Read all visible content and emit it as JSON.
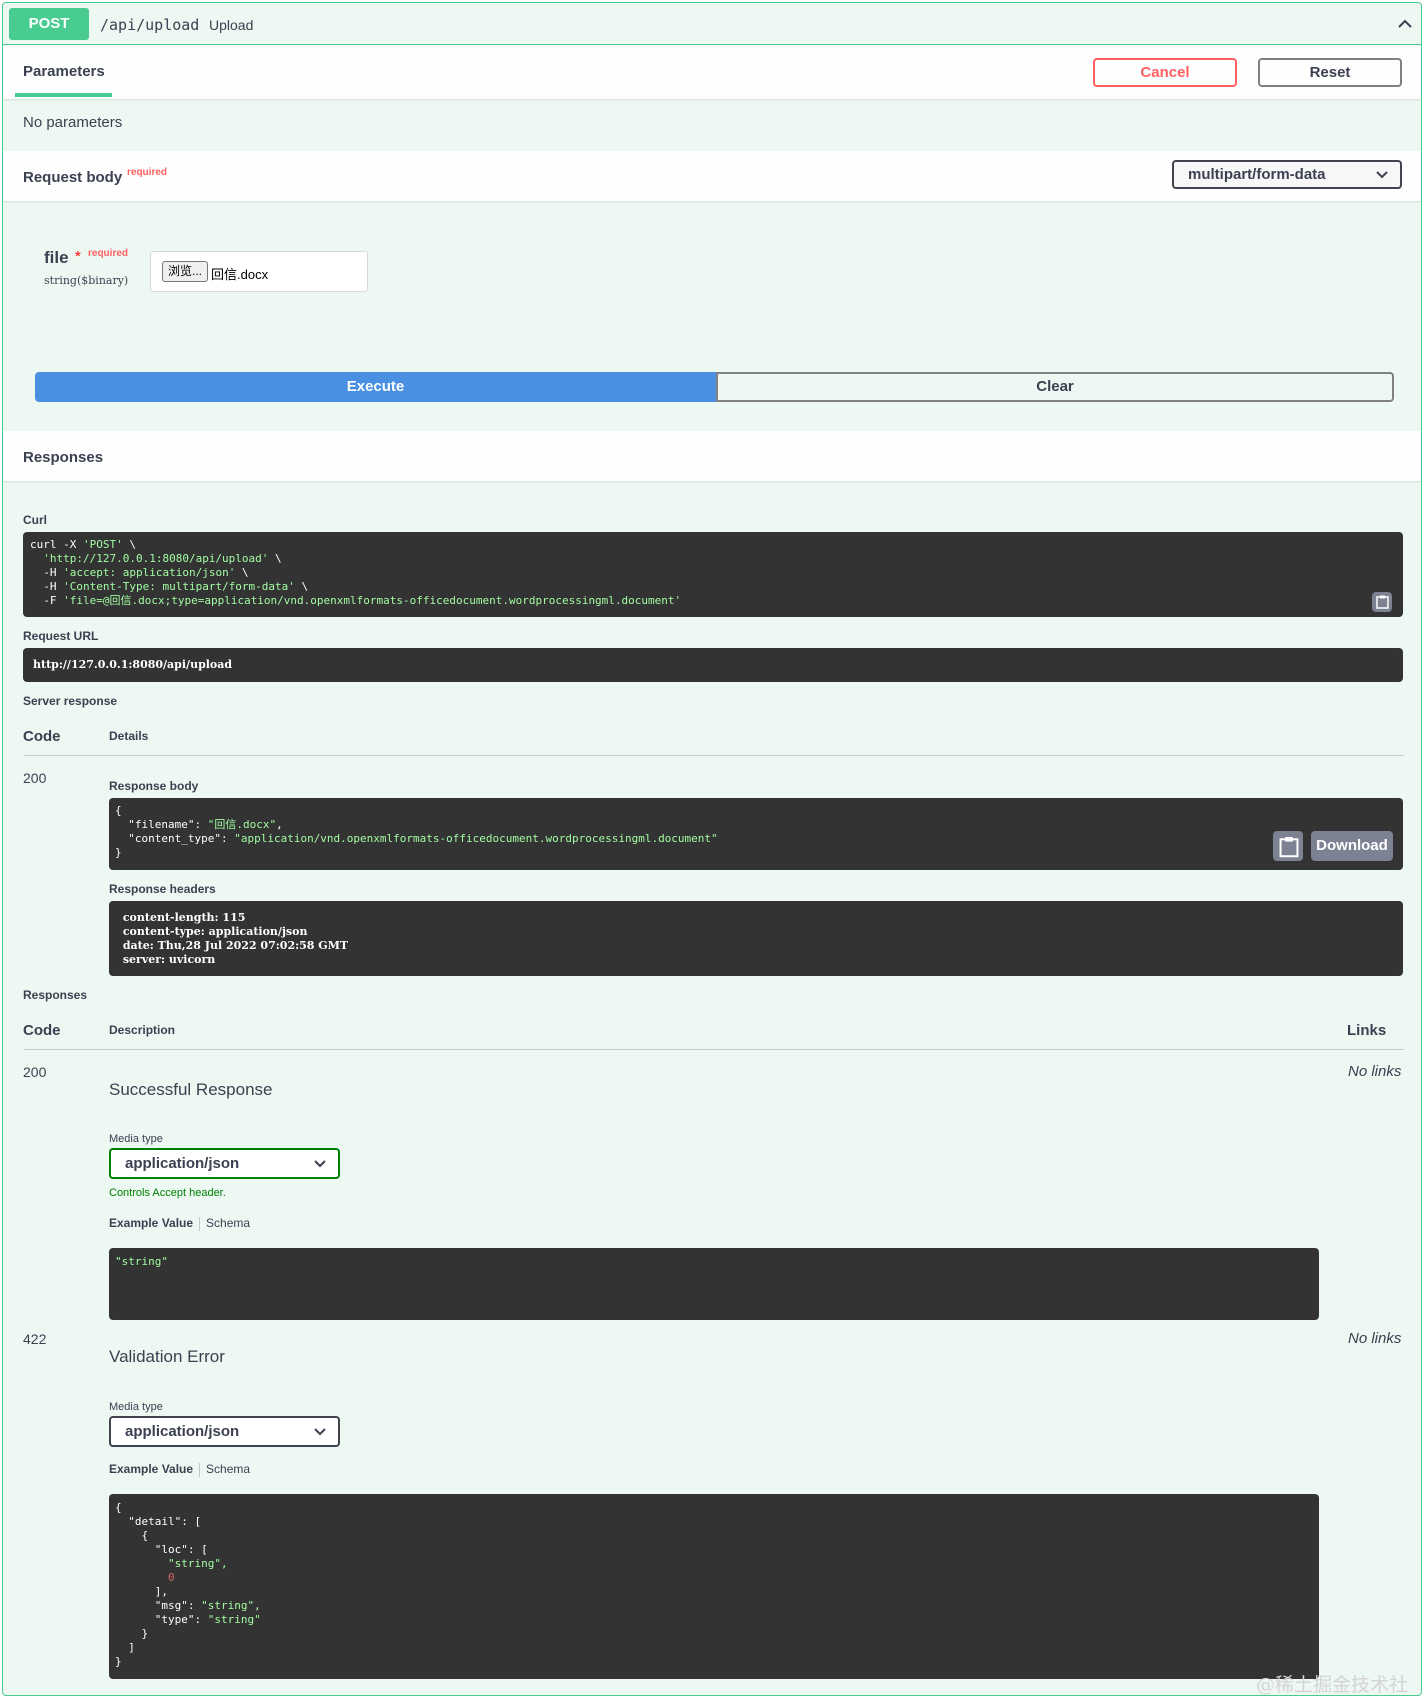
{
  "operation": {
    "method": "POST",
    "path": "/api/upload",
    "summary": "Upload"
  },
  "parameters": {
    "tab_label": "Parameters",
    "cancel_label": "Cancel",
    "reset_label": "Reset",
    "empty_text": "No parameters"
  },
  "request_body": {
    "title": "Request body",
    "required_label": "required",
    "content_type": "multipart/form-data",
    "file_field": {
      "name": "file",
      "star": "*",
      "required_label": "required",
      "type": "string($binary)",
      "browse_label": "浏览...",
      "filename": "回信.docx"
    }
  },
  "actions": {
    "execute_label": "Execute",
    "clear_label": "Clear"
  },
  "responses_section": {
    "title": "Responses",
    "curl_label": "Curl",
    "curl_lines": {
      "l1_a": "curl -X ",
      "l1_b": "'POST'",
      "l1_c": " \\",
      "l2_a": "  ",
      "l2_b": "'http://127.0.0.1:8080/api/upload'",
      "l2_c": " \\",
      "l3_a": "  -H ",
      "l3_b": "'accept: application/json'",
      "l3_c": " \\",
      "l4_a": "  -H ",
      "l4_b": "'Content-Type: multipart/form-data'",
      "l4_c": " \\",
      "l5_a": "  -F ",
      "l5_b": "'file=@回信.docx;type=application/vnd.openxmlformats-officedocument.wordprocessingml.document'"
    },
    "request_url_label": "Request URL",
    "request_url": "http://127.0.0.1:8080/api/upload",
    "server_response_label": "Server response",
    "code_header": "Code",
    "details_header": "Details",
    "status_code": "200",
    "response_body_label": "Response body",
    "response_body": {
      "l1": "{",
      "l2_a": "  \"filename\": ",
      "l2_b": "\"回信.docx\"",
      "l2_c": ",",
      "l3_a": "  \"content_type\": ",
      "l3_b": "\"application/vnd.openxmlformats-officedocument.wordprocessingml.document\"",
      "l4": "}"
    },
    "download_label": "Download",
    "response_headers_label": "Response headers",
    "response_headers": {
      "l1": " content-length: 115",
      "l2": " content-type: application/json",
      "l3": " date: Thu,28 Jul 2022 07:02:58 GMT",
      "l4": " server: uvicorn"
    }
  },
  "responses_table": {
    "label": "Responses",
    "code_header": "Code",
    "description_header": "Description",
    "links_header": "Links",
    "rows": [
      {
        "code": "200",
        "description": "Successful Response",
        "links": "No links",
        "media_type_label": "Media type",
        "media_type": "application/json",
        "accept_note": "Controls Accept header.",
        "example_value_label": "Example Value",
        "schema_label": "Schema",
        "example": "\"string\""
      },
      {
        "code": "422",
        "description": "Validation Error",
        "links": "No links",
        "media_type_label": "Media type",
        "media_type": "application/json",
        "example_value_label": "Example Value",
        "schema_label": "Schema",
        "example_lines": {
          "l1": "{",
          "l2": "  \"detail\": [",
          "l3": "    {",
          "l4": "      \"loc\": [",
          "l5": "        \"string\",",
          "l6": "        0",
          "l7": "      ],",
          "l8_a": "      \"msg\": ",
          "l8_b": "\"string\",",
          "l9_a": "      \"type\": ",
          "l9_b": "\"string\"",
          "l10": "    }",
          "l11": "  ]",
          "l12": "}"
        }
      }
    ]
  },
  "watermark": "@稀土掘金技术社区",
  "colors": {
    "post_green": "#49cc90",
    "execute_blue": "#4990e2",
    "cancel_red": "#ff6060",
    "code_bg": "#333333",
    "string_green": "#a2fca2"
  }
}
